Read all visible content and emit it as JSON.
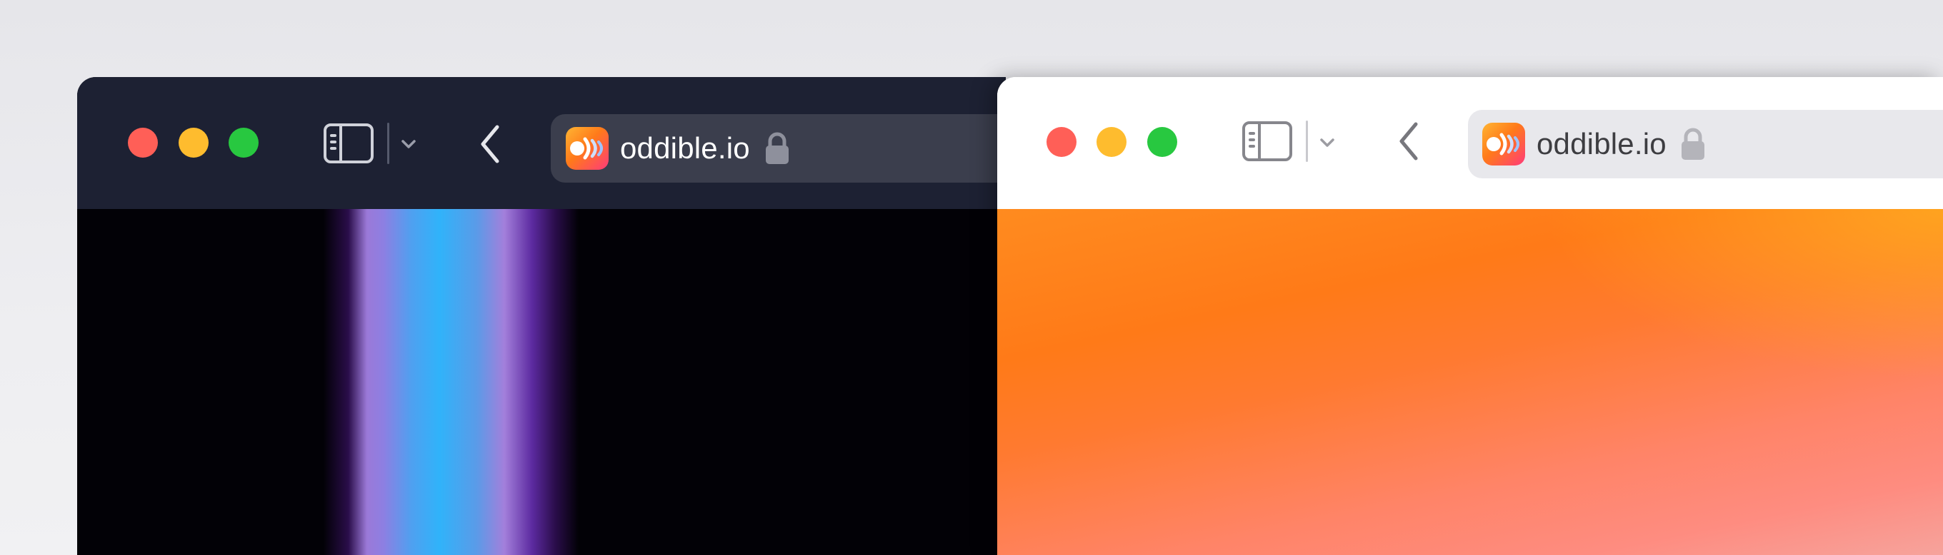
{
  "windows": [
    {
      "theme": "dark",
      "address_bar": {
        "site_name": "oddible.io",
        "site_icon": "oddible-logo-icon",
        "secure_icon": "lock-icon"
      },
      "controls": [
        "close-button",
        "minimize-button",
        "zoom-button",
        "sidebar-toggle-icon",
        "tab-group-chevron-icon",
        "back-chevron-icon"
      ]
    },
    {
      "theme": "light",
      "address_bar": {
        "site_name": "oddible.io",
        "site_icon": "oddible-logo-icon",
        "secure_icon": "lock-icon"
      },
      "controls": [
        "close-button",
        "minimize-button",
        "zoom-button",
        "sidebar-toggle-icon",
        "tab-group-chevron-icon",
        "back-chevron-icon"
      ]
    }
  ],
  "colors": {
    "close": "#ff5f57",
    "minimize": "#febc2e",
    "zoom": "#28c840",
    "dark_toolbar": "#1d2133",
    "dark_urlbar": "#3b3e4d",
    "light_urlbar": "#e8e8ec",
    "brand_orange": "#ff7a1a"
  }
}
